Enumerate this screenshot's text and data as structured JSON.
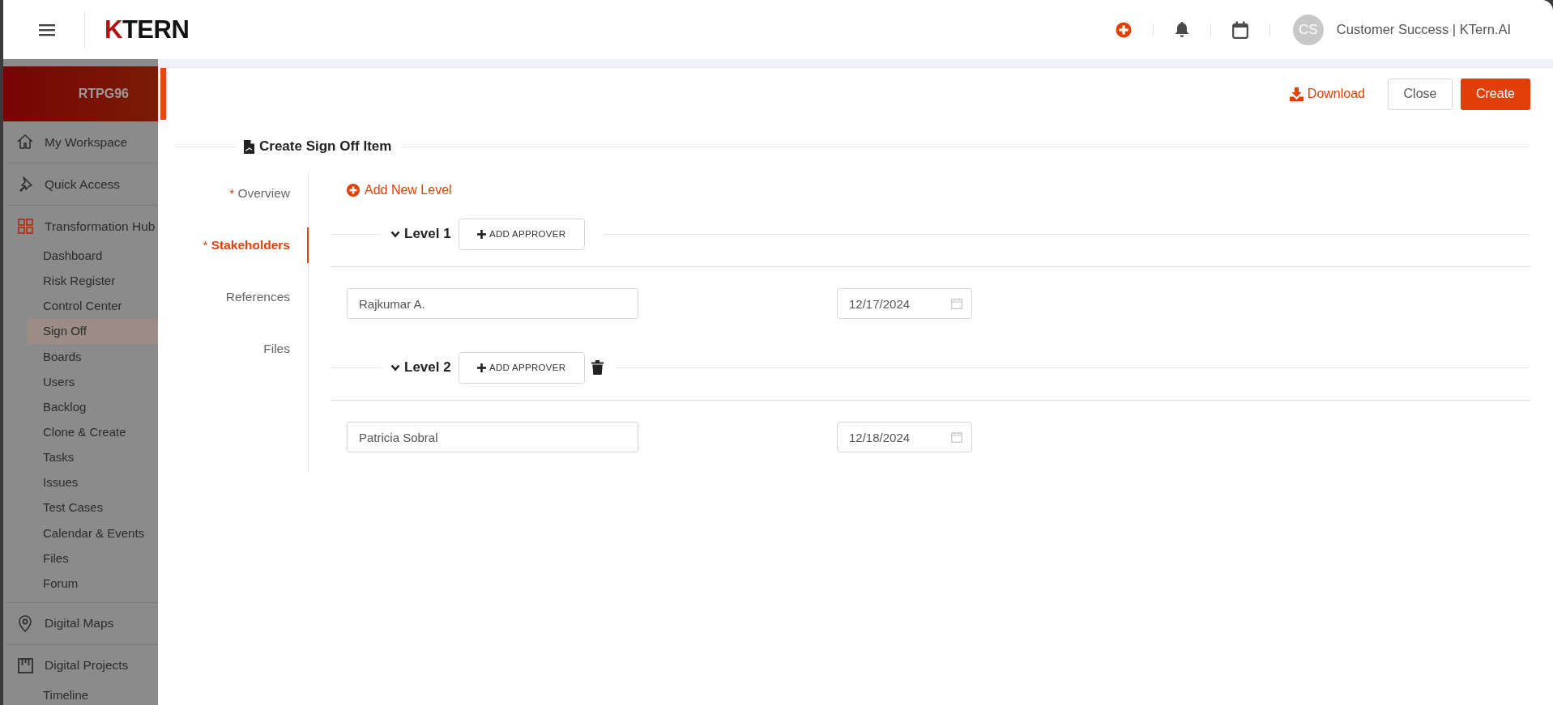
{
  "topbar": {
    "logo": "KTERN",
    "user_initials": "CS",
    "user_name": "Customer Success | KTern.AI"
  },
  "sidebar": {
    "project": "RTPG96",
    "sections": [
      {
        "label": "My Workspace",
        "kind": "home",
        "selected": false
      },
      {
        "label": "Quick Access",
        "kind": "pin",
        "selected": false
      },
      {
        "label": "Transformation Hub",
        "kind": "grid",
        "selected": true,
        "children": [
          {
            "label": "Dashboard",
            "selected": false
          },
          {
            "label": "Risk Register",
            "selected": false
          },
          {
            "label": "Control Center",
            "selected": false
          },
          {
            "label": "Sign Off",
            "selected": true
          },
          {
            "label": "Boards",
            "selected": false
          },
          {
            "label": "Users",
            "selected": false
          },
          {
            "label": "Backlog",
            "selected": false
          },
          {
            "label": "Clone & Create",
            "selected": false
          },
          {
            "label": "Tasks",
            "selected": false
          },
          {
            "label": "Issues",
            "selected": false
          },
          {
            "label": "Test Cases",
            "selected": false
          },
          {
            "label": "Calendar & Events",
            "selected": false
          },
          {
            "label": "Files",
            "selected": false
          },
          {
            "label": "Forum",
            "selected": false
          }
        ]
      },
      {
        "label": "Digital Maps",
        "kind": "map-pin",
        "selected": false
      },
      {
        "label": "Digital Projects",
        "kind": "board",
        "selected": false,
        "children": [
          {
            "label": "Timeline",
            "selected": false
          }
        ]
      }
    ]
  },
  "form": {
    "actions": {
      "download": "Download",
      "close": "Close",
      "create": "Create"
    },
    "title": "Create Sign Off Item",
    "nav": [
      {
        "mark": "*",
        "label": "Overview",
        "selected": false
      },
      {
        "mark": "*",
        "label": "Stakeholders",
        "selected": true
      },
      {
        "label": "References",
        "selected": false
      },
      {
        "label": "Files",
        "selected": false
      }
    ],
    "add_level": "Add New Level",
    "levels": [
      {
        "title": "Level 1",
        "expanded": true,
        "add_label": "ADD APPROVER",
        "deletable": false,
        "approvers": [
          {
            "name": "Rajkumar A.",
            "date": "12/17/2024"
          }
        ]
      },
      {
        "title": "Level 2",
        "expanded": true,
        "add_label": "ADD APPROVER",
        "deletable": true,
        "approvers": [
          {
            "name": "Patricia Sobral",
            "date": "12/18/2024"
          }
        ]
      }
    ]
  }
}
